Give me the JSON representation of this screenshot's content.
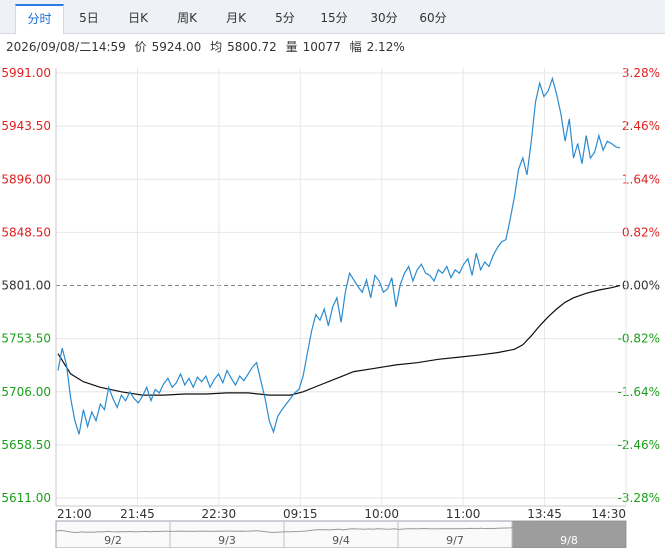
{
  "tabs": [
    {
      "label": "分时",
      "active": true
    },
    {
      "label": "5日",
      "active": false
    },
    {
      "label": "日K",
      "active": false
    },
    {
      "label": "周K",
      "active": false
    },
    {
      "label": "月K",
      "active": false
    },
    {
      "label": "5分",
      "active": false
    },
    {
      "label": "15分",
      "active": false
    },
    {
      "label": "30分",
      "active": false
    },
    {
      "label": "60分",
      "active": false
    }
  ],
  "info": {
    "datetime": "2026/09/08/二14:59",
    "price_label": "价",
    "price": "5924.00",
    "avg_label": "均",
    "avg": "5800.72",
    "volume_label": "量",
    "volume": "10077",
    "change_label": "幅",
    "change": "2.12%"
  },
  "colors": {
    "up": "#e02020",
    "down": "#1aa01a",
    "neutral": "#333333",
    "price_line": "#2a8bd0",
    "avg_line": "#111111",
    "grid": "#e6e6e6",
    "active_tab": "#1769d4"
  },
  "chart_data": {
    "type": "line",
    "y_left_ticks": [
      "5991.00",
      "5943.50",
      "5896.00",
      "5848.50",
      "5801.00",
      "5753.50",
      "5706.00",
      "5658.50",
      "5611.00"
    ],
    "y_right_ticks": [
      "3.28%",
      "2.46%",
      "1.64%",
      "0.82%",
      "0.00%",
      "-0.82%",
      "-1.64%",
      "-2.46%",
      "-3.28%"
    ],
    "x_ticks": [
      "21:00",
      "21:45",
      "22:30",
      "09:15",
      "10:00",
      "11:00",
      "13:45",
      "14:30"
    ],
    "ylim": [
      5611.0,
      5991.0
    ],
    "reference_value": 5801.0,
    "price_series": [
      [
        0,
        5725
      ],
      [
        1,
        5745
      ],
      [
        2,
        5730
      ],
      [
        3,
        5700
      ],
      [
        4,
        5680
      ],
      [
        5,
        5668
      ],
      [
        6,
        5690
      ],
      [
        7,
        5675
      ],
      [
        8,
        5688
      ],
      [
        9,
        5680
      ],
      [
        10,
        5695
      ],
      [
        11,
        5690
      ],
      [
        12,
        5710
      ],
      [
        13,
        5700
      ],
      [
        14,
        5692
      ],
      [
        15,
        5703
      ],
      [
        16,
        5698
      ],
      [
        17,
        5706
      ],
      [
        18,
        5700
      ],
      [
        19,
        5696
      ],
      [
        20,
        5702
      ],
      [
        21,
        5710
      ],
      [
        22,
        5698
      ],
      [
        23,
        5708
      ],
      [
        24,
        5705
      ],
      [
        25,
        5713
      ],
      [
        26,
        5718
      ],
      [
        27,
        5710
      ],
      [
        28,
        5714
      ],
      [
        29,
        5722
      ],
      [
        30,
        5712
      ],
      [
        31,
        5718
      ],
      [
        32,
        5710
      ],
      [
        33,
        5719
      ],
      [
        34,
        5715
      ],
      [
        35,
        5720
      ],
      [
        36,
        5710
      ],
      [
        37,
        5717
      ],
      [
        38,
        5722
      ],
      [
        39,
        5714
      ],
      [
        40,
        5725
      ],
      [
        41,
        5718
      ],
      [
        42,
        5712
      ],
      [
        43,
        5720
      ],
      [
        44,
        5716
      ],
      [
        45,
        5722
      ],
      [
        46,
        5728
      ],
      [
        47,
        5732
      ],
      [
        48,
        5716
      ],
      [
        49,
        5700
      ],
      [
        50,
        5680
      ],
      [
        51,
        5670
      ],
      [
        52,
        5684
      ],
      [
        53,
        5690
      ],
      [
        54,
        5695
      ],
      [
        55,
        5700
      ],
      [
        56,
        5705
      ],
      [
        57,
        5708
      ],
      [
        58,
        5720
      ],
      [
        59,
        5740
      ],
      [
        60,
        5760
      ],
      [
        61,
        5775
      ],
      [
        62,
        5770
      ],
      [
        63,
        5780
      ],
      [
        64,
        5765
      ],
      [
        65,
        5782
      ],
      [
        66,
        5790
      ],
      [
        67,
        5768
      ],
      [
        68,
        5795
      ],
      [
        69,
        5812
      ],
      [
        70,
        5806
      ],
      [
        71,
        5800
      ],
      [
        72,
        5795
      ],
      [
        73,
        5806
      ],
      [
        74,
        5790
      ],
      [
        75,
        5810
      ],
      [
        76,
        5805
      ],
      [
        77,
        5795
      ],
      [
        78,
        5798
      ],
      [
        79,
        5808
      ],
      [
        80,
        5782
      ],
      [
        81,
        5802
      ],
      [
        82,
        5812
      ],
      [
        83,
        5818
      ],
      [
        84,
        5805
      ],
      [
        85,
        5815
      ],
      [
        86,
        5820
      ],
      [
        87,
        5812
      ],
      [
        88,
        5810
      ],
      [
        89,
        5805
      ],
      [
        90,
        5815
      ],
      [
        91,
        5812
      ],
      [
        92,
        5818
      ],
      [
        93,
        5808
      ],
      [
        94,
        5815
      ],
      [
        95,
        5812
      ],
      [
        96,
        5820
      ],
      [
        97,
        5825
      ],
      [
        98,
        5810
      ],
      [
        99,
        5830
      ],
      [
        100,
        5815
      ],
      [
        101,
        5822
      ],
      [
        102,
        5818
      ],
      [
        103,
        5828
      ],
      [
        104,
        5835
      ],
      [
        105,
        5840
      ],
      [
        106,
        5842
      ],
      [
        107,
        5860
      ],
      [
        108,
        5880
      ],
      [
        109,
        5905
      ],
      [
        110,
        5915
      ],
      [
        111,
        5900
      ],
      [
        112,
        5930
      ],
      [
        113,
        5965
      ],
      [
        114,
        5982
      ],
      [
        115,
        5970
      ],
      [
        116,
        5975
      ],
      [
        117,
        5986
      ],
      [
        118,
        5972
      ],
      [
        119,
        5955
      ],
      [
        120,
        5930
      ],
      [
        121,
        5950
      ],
      [
        122,
        5915
      ],
      [
        123,
        5928
      ],
      [
        124,
        5910
      ],
      [
        125,
        5935
      ],
      [
        126,
        5915
      ],
      [
        127,
        5920
      ],
      [
        128,
        5935
      ],
      [
        129,
        5922
      ],
      [
        130,
        5930
      ],
      [
        131,
        5928
      ],
      [
        132,
        5925
      ],
      [
        133,
        5924
      ]
    ],
    "avg_series": [
      [
        0,
        5740
      ],
      [
        3,
        5722
      ],
      [
        6,
        5715
      ],
      [
        10,
        5710
      ],
      [
        15,
        5706
      ],
      [
        20,
        5703
      ],
      [
        25,
        5703
      ],
      [
        30,
        5704
      ],
      [
        35,
        5704
      ],
      [
        40,
        5705
      ],
      [
        45,
        5705
      ],
      [
        50,
        5703
      ],
      [
        55,
        5703
      ],
      [
        58,
        5706
      ],
      [
        62,
        5712
      ],
      [
        66,
        5718
      ],
      [
        70,
        5724
      ],
      [
        75,
        5727
      ],
      [
        80,
        5730
      ],
      [
        85,
        5732
      ],
      [
        90,
        5735
      ],
      [
        95,
        5737
      ],
      [
        100,
        5739
      ],
      [
        104,
        5741
      ],
      [
        108,
        5744
      ],
      [
        110,
        5748
      ],
      [
        112,
        5756
      ],
      [
        114,
        5765
      ],
      [
        116,
        5773
      ],
      [
        118,
        5780
      ],
      [
        120,
        5786
      ],
      [
        122,
        5790
      ],
      [
        125,
        5794
      ],
      [
        128,
        5797
      ],
      [
        131,
        5799
      ],
      [
        133,
        5801
      ]
    ],
    "total_points": 133
  },
  "navigator": {
    "day_labels": [
      "9/2",
      "9/3",
      "9/4",
      "9/7",
      "9/8"
    ]
  }
}
